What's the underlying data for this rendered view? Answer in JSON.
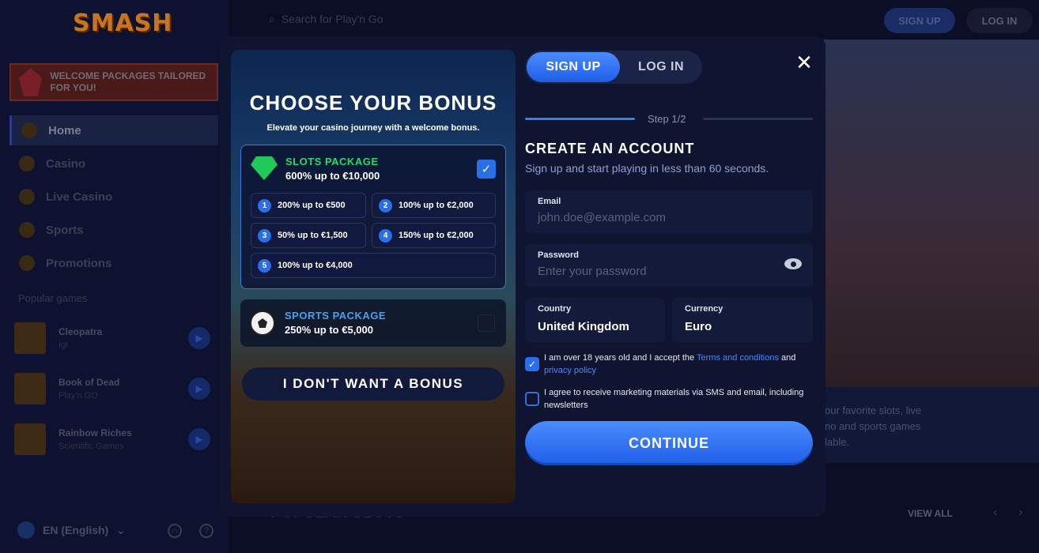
{
  "background": {
    "logo": "SMASH",
    "promo_banner": "WELCOME PACKAGES TAILORED FOR YOU!",
    "search_placeholder": "Search for Play'n Go",
    "signup_label": "SIGN UP",
    "login_label": "LOG IN",
    "nav": [
      {
        "label": "Home",
        "icon": "home-icon"
      },
      {
        "label": "Casino",
        "icon": "spade-icon"
      },
      {
        "label": "Live Casino",
        "icon": "dice-icon"
      },
      {
        "label": "Sports",
        "icon": "ball-icon"
      },
      {
        "label": "Promotions",
        "icon": "gift-icon"
      }
    ],
    "popular_games_title": "Popular games",
    "games": [
      {
        "name": "Cleopatra",
        "provider": "Igt"
      },
      {
        "name": "Book of Dead",
        "provider": "Play'n GO"
      },
      {
        "name": "Rainbow Riches",
        "provider": "Scientific Games"
      }
    ],
    "language": "EN (English)",
    "info_text": "our favorite slots, live no and sports games lable.",
    "popular_slots": "POPULAR SLOTS",
    "view_all": "VIEW ALL"
  },
  "bonus": {
    "title": "CHOOSE YOUR BONUS",
    "subtitle": "Elevate your casino journey with a welcome bonus.",
    "slots": {
      "name": "SLOTS PACKAGE",
      "value": "600% up to €10,000",
      "selected": true,
      "tiers": [
        {
          "num": "1",
          "text": "200% up to €500"
        },
        {
          "num": "2",
          "text": "100% up to €2,000"
        },
        {
          "num": "3",
          "text": "50% up to €1,500"
        },
        {
          "num": "4",
          "text": "150% up to €2,000"
        },
        {
          "num": "5",
          "text": "100% up to €4,000"
        }
      ]
    },
    "sports": {
      "name": "SPORTS PACKAGE",
      "value": "250% up to €5,000",
      "selected": false
    },
    "no_bonus": "I DON'T WANT A BONUS"
  },
  "form": {
    "tab_signup": "SIGN UP",
    "tab_login": "LOG IN",
    "step": "Step 1/2",
    "title": "CREATE AN ACCOUNT",
    "subtitle": "Sign up and start playing in less than 60 seconds.",
    "email_label": "Email",
    "email_placeholder": "john.doe@example.com",
    "password_label": "Password",
    "password_placeholder": "Enter your password",
    "country_label": "Country",
    "country_value": "United Kingdom",
    "currency_label": "Currency",
    "currency_value": "Euro",
    "terms_prefix": "I am over 18 years old and I accept the",
    "terms_link": "Terms and conditions",
    "terms_and": "and",
    "privacy_link": "privacy policy",
    "terms_checked": true,
    "marketing_text": "I agree to receive marketing materials via SMS and email, including newsletters",
    "marketing_checked": false,
    "continue": "CONTINUE"
  },
  "colors": {
    "accent": "#2a6ee8",
    "slots_green": "#2cd86a",
    "sports_blue": "#4aa0f0"
  }
}
